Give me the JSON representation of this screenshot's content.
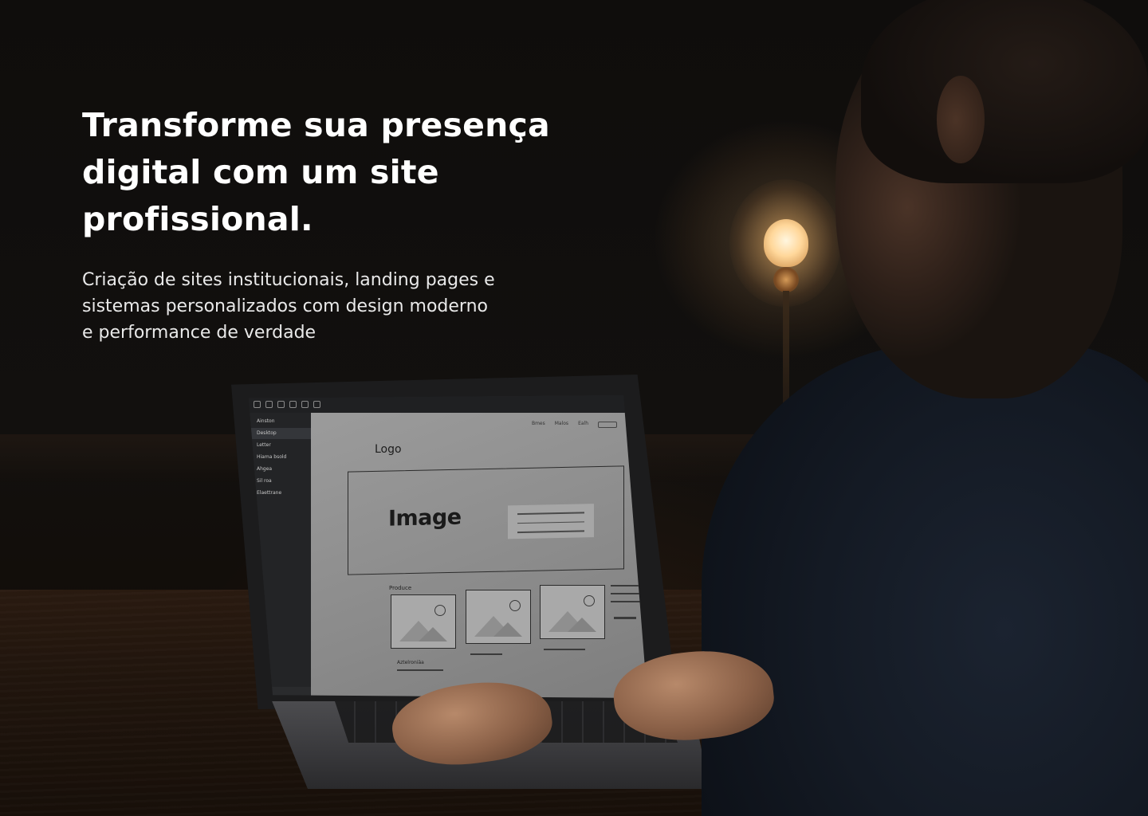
{
  "hero": {
    "title_line1": "Transforme sua presença",
    "title_line2": "digital com um site",
    "title_line3": "profissional.",
    "subtitle_line1": "Criação de sites institucionais, landing pages e",
    "subtitle_line2": "sistemas personalizados com design moderno",
    "subtitle_line3": "e performance de verdade"
  },
  "laptop_screen": {
    "sidebar_items": [
      "Ainston",
      "Desktop",
      "Letter",
      "Hiama bsold",
      "Ahgea",
      "Sil roa",
      "Elaettrane"
    ],
    "nav_links": [
      "Bmes",
      "Malos",
      "Ealh"
    ],
    "logo_label": "Logo",
    "image_label": "Image",
    "section_label": "Produce",
    "footer_label": "Aztelroniäa"
  },
  "colors": {
    "background": "#0b0a09",
    "title_text": "#ffffff",
    "subtitle_text": "#e9e9e9",
    "lamp_glow": "#ffd79a"
  }
}
